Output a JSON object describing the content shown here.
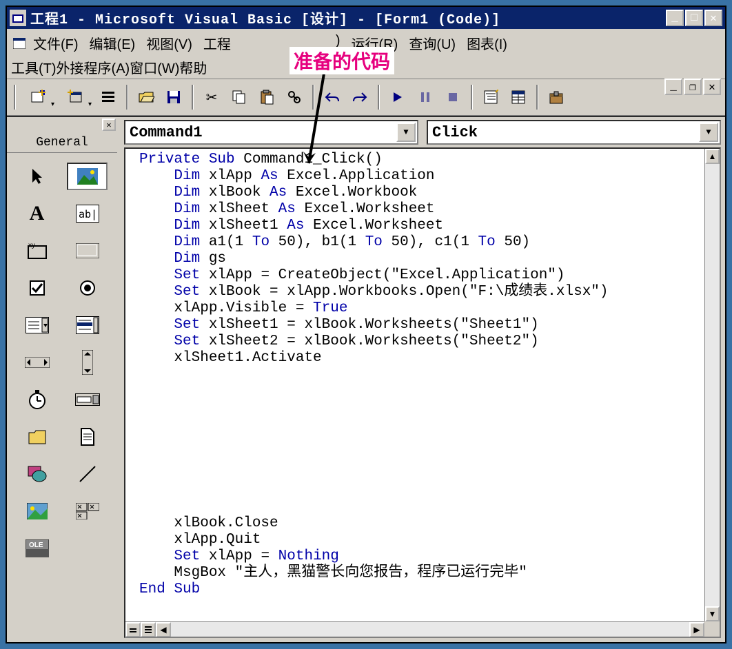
{
  "titlebar": {
    "title": "工程1 - Microsoft Visual Basic [设计] - [Form1 (Code)]"
  },
  "menu": {
    "file": "文件(F)",
    "edit": "编辑(E)",
    "view": "视图(V)",
    "project": "工程",
    "format": ")",
    "run": "运行(R)",
    "query": "查询(U)",
    "diagram": "图表(I)",
    "tools": "工具(T)",
    "addins": "外接程序(A)",
    "window": "窗口(W)",
    "help": "帮助"
  },
  "annotation": {
    "label": "准备的代码"
  },
  "toolbox": {
    "header": "General"
  },
  "combos": {
    "object": "Command1",
    "event": "Click"
  },
  "code": {
    "lines": [
      {
        "t": "Private Sub ",
        "k": true,
        "i": 0
      },
      {
        "t": "Command1_Click()",
        "k": false
      },
      {
        "t": "\n",
        "k": false
      },
      {
        "t": "    Dim ",
        "k": true
      },
      {
        "t": "xlApp ",
        "k": false
      },
      {
        "t": "As ",
        "k": true
      },
      {
        "t": "Excel.Application\n",
        "k": false
      },
      {
        "t": "    Dim ",
        "k": true
      },
      {
        "t": "xlBook ",
        "k": false
      },
      {
        "t": "As ",
        "k": true
      },
      {
        "t": "Excel.Workbook\n",
        "k": false
      },
      {
        "t": "    Dim ",
        "k": true
      },
      {
        "t": "xlSheet ",
        "k": false
      },
      {
        "t": "As ",
        "k": true
      },
      {
        "t": "Excel.Worksheet\n",
        "k": false
      },
      {
        "t": "    Dim ",
        "k": true
      },
      {
        "t": "xlSheet1 ",
        "k": false
      },
      {
        "t": "As ",
        "k": true
      },
      {
        "t": "Excel.Worksheet\n",
        "k": false
      },
      {
        "t": "    Dim ",
        "k": true
      },
      {
        "t": "a1(1 ",
        "k": false
      },
      {
        "t": "To ",
        "k": true
      },
      {
        "t": "50), b1(1 ",
        "k": false
      },
      {
        "t": "To ",
        "k": true
      },
      {
        "t": "50), c1(1 ",
        "k": false
      },
      {
        "t": "To ",
        "k": true
      },
      {
        "t": "50)\n",
        "k": false
      },
      {
        "t": "    Dim ",
        "k": true
      },
      {
        "t": "gs\n",
        "k": false
      },
      {
        "t": "    Set ",
        "k": true
      },
      {
        "t": "xlApp = CreateObject(\"Excel.Application\")\n",
        "k": false
      },
      {
        "t": "    Set ",
        "k": true
      },
      {
        "t": "xlBook = xlApp.Workbooks.Open(\"F:\\成绩表.xlsx\")\n",
        "k": false
      },
      {
        "t": "    xlApp.Visible = ",
        "k": false
      },
      {
        "t": "True\n",
        "k": true
      },
      {
        "t": "    Set ",
        "k": true
      },
      {
        "t": "xlSheet1 = xlBook.Worksheets(\"Sheet1\")\n",
        "k": false
      },
      {
        "t": "    Set ",
        "k": true
      },
      {
        "t": "xlSheet2 = xlBook.Worksheets(\"Sheet2\")\n",
        "k": false
      },
      {
        "t": "    xlSheet1.Activate\n\n\n\n\n\n\n\n\n\n",
        "k": false
      },
      {
        "t": "    xlBook.Close\n",
        "k": false
      },
      {
        "t": "    xlApp.Quit\n",
        "k": false
      },
      {
        "t": "    Set ",
        "k": true
      },
      {
        "t": "xlApp = ",
        "k": false
      },
      {
        "t": "Nothing\n",
        "k": true
      },
      {
        "t": "    MsgBox \"主人，黑猫警长向您报告，程序已运行完毕\"\n",
        "k": false
      },
      {
        "t": "End Sub",
        "k": true
      }
    ]
  }
}
